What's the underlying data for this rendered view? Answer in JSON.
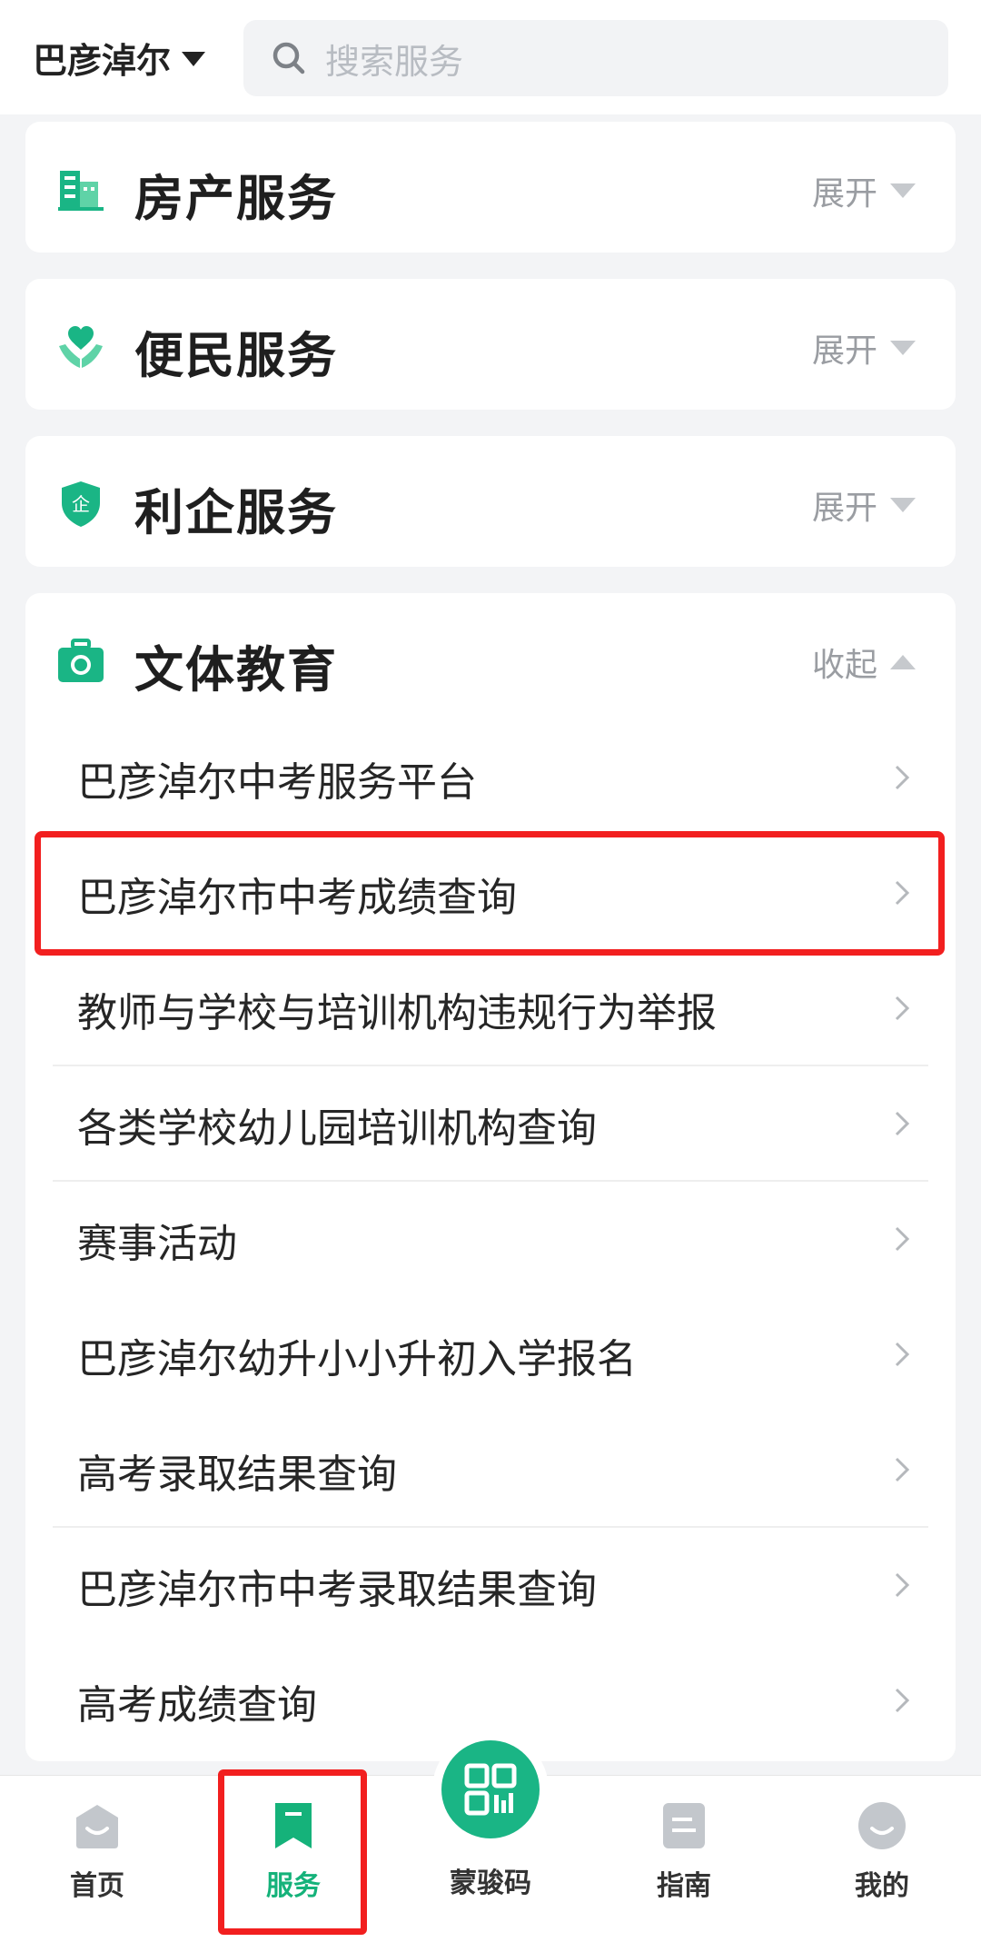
{
  "header": {
    "city": "巴彦淖尔",
    "search_placeholder": "搜索服务"
  },
  "categories": [
    {
      "title": "房产服务",
      "toggle": "展开",
      "icon": "building-icon"
    },
    {
      "title": "便民服务",
      "toggle": "展开",
      "icon": "heart-hand-icon"
    },
    {
      "title": "利企服务",
      "toggle": "展开",
      "icon": "shield-enterprise-icon"
    },
    {
      "title": "文体教育",
      "toggle": "收起",
      "icon": "briefcase-icon"
    }
  ],
  "education_items": [
    "巴彦淖尔中考服务平台",
    "巴彦淖尔市中考成绩查询",
    "教师与学校与培训机构违规行为举报",
    "各类学校幼儿园培训机构查询",
    "赛事活动",
    "巴彦淖尔幼升小小升初入学报名",
    "高考录取结果查询",
    "巴彦淖尔市中考录取结果查询",
    "高考成绩查询"
  ],
  "bottom_nav": {
    "home": "首页",
    "services": "服务",
    "code": "蒙骏码",
    "guide": "指南",
    "mine": "我的"
  },
  "colors": {
    "accent": "#15b27a",
    "highlight": "#f21f1f"
  }
}
